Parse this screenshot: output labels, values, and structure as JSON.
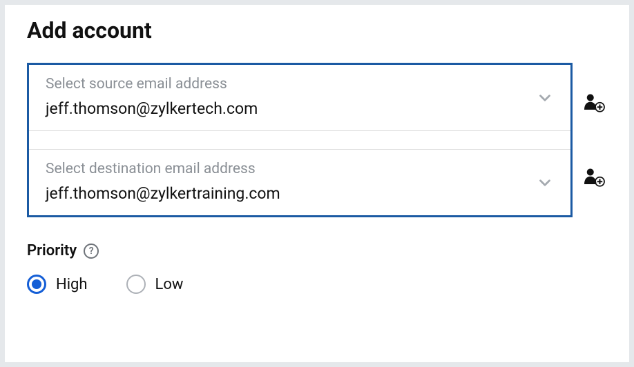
{
  "title": "Add account",
  "source": {
    "label": "Select source email address",
    "value": "jeff.thomson@zylkertech.com"
  },
  "destination": {
    "label": "Select destination email address",
    "value": "jeff.thomson@zylkertraining.com"
  },
  "priority": {
    "label": "Priority",
    "options": {
      "high": "High",
      "low": "Low"
    },
    "selected": "high"
  }
}
